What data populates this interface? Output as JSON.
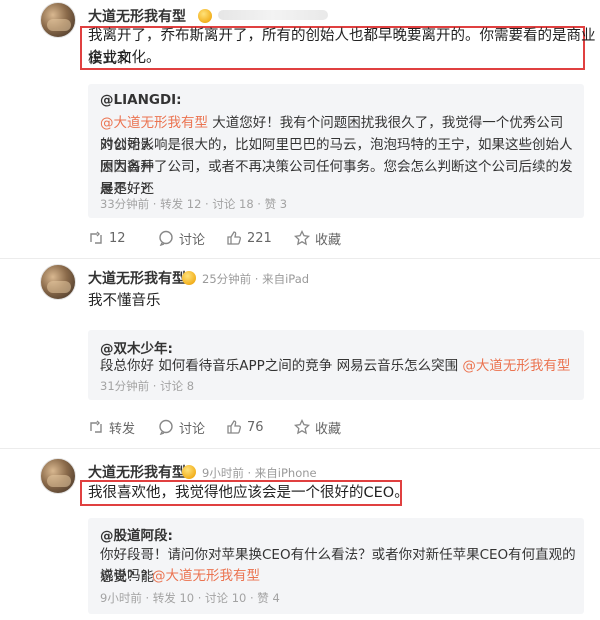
{
  "posts": [
    {
      "author": "大道无形我有型",
      "text_line1": "我离开了，乔布斯离开了，所有的创始人也都早晚要离开的。你需要看的是商业模式和",
      "text_line2": "企业文化。",
      "repost": {
        "user": "@LIANGDI:",
        "mention": "@大道无形我有型",
        "text_line1_rest": " 大道您好！我有个问题困扰我很久了，我觉得一个优秀公司的创始人",
        "text_line2": "对公司影响是很大的，比如阿里巴巴的马云，泡泡玛特的王宁，如果这些创始人因为各种",
        "text_line3": "原因离开了公司，或者不再决策公司任何事务。您会怎么判断这个公司后续的发展是好还",
        "text_line4": "是不好?",
        "meta": "33分钟前 · 转发 12 · 讨论 18 · 赞 3"
      },
      "actions": {
        "repost_count": "12",
        "comment_label": "讨论",
        "like_count": "221",
        "fav_label": "收藏"
      }
    },
    {
      "author": "大道无形我有型",
      "meta": "25分钟前 · 来自iPad",
      "text_line1": "我不懂音乐",
      "repost": {
        "user": "@双木少年:",
        "text_line1": "段总你好 如何看待音乐APP之间的竞争 网易云音乐怎么突围 ",
        "mention": "@大道无形我有型",
        "meta": "31分钟前 · 讨论 8"
      },
      "actions": {
        "repost_label": "转发",
        "comment_label": "讨论",
        "like_count": "76",
        "fav_label": "收藏"
      }
    },
    {
      "author": "大道无形我有型",
      "meta": "9小时前 · 来自iPhone",
      "text_line1": "我很喜欢他，我觉得他应该会是一个很好的CEO。",
      "repost": {
        "user": "@股道阿段:",
        "text_line1": "你好段哥！请问你对苹果换CEO有什么看法？或者你对新任苹果CEO有何直观的感受？能",
        "text_line2_text": "说说吗? ",
        "mention": "@大道无形我有型",
        "meta": "9小时前 · 转发 10 · 讨论 10 · 赞 4"
      }
    }
  ],
  "colors": {
    "link": "#eb7350",
    "highlight": "#e04040",
    "repost_bg": "#f4f5f7"
  },
  "icons": [
    "crown-badge-icon",
    "repost-icon",
    "comment-icon",
    "like-icon",
    "favorite-icon"
  ]
}
